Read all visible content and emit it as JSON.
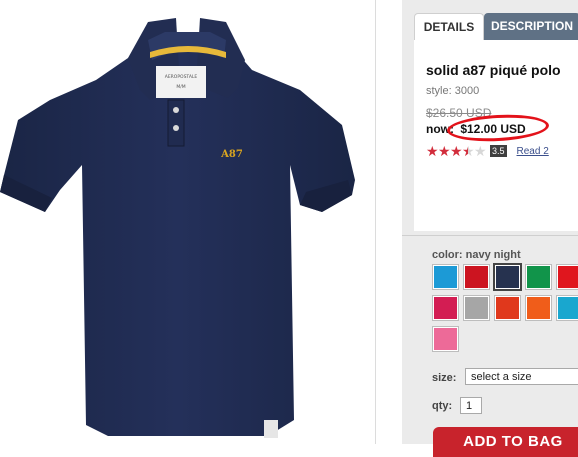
{
  "tabs": {
    "details": "DETAILS",
    "description": "DESCRIPTION"
  },
  "product": {
    "title": "solid a87 piqué polo",
    "style": "style: 3000",
    "old_price": "$26.50 USD",
    "now_label": "now: ",
    "now_price": "$12.00 USD",
    "rating": "3.5",
    "rating_value": 3.5,
    "rating_max": 5,
    "read_reviews": "Read 2",
    "shirt_label_brand": "AEROPOSTALE",
    "shirt_label_size": "M/M"
  },
  "color": {
    "label": "color: navy night",
    "swatches": [
      {
        "name": "teal-blue",
        "hex": "#1c9ad6",
        "selected": false
      },
      {
        "name": "red",
        "hex": "#cc1420",
        "selected": false
      },
      {
        "name": "navy-night",
        "hex": "#26324f",
        "selected": true
      },
      {
        "name": "green",
        "hex": "#11944a",
        "selected": false
      },
      {
        "name": "bright-red",
        "hex": "#e0161e",
        "selected": false
      },
      {
        "name": "raspberry",
        "hex": "#d31d53",
        "selected": false
      },
      {
        "name": "gray",
        "hex": "#a6a6a6",
        "selected": false
      },
      {
        "name": "orange-red",
        "hex": "#e0381c",
        "selected": false
      },
      {
        "name": "orange",
        "hex": "#f05d1a",
        "selected": false
      },
      {
        "name": "turquoise",
        "hex": "#19a7cf",
        "selected": false
      },
      {
        "name": "pink",
        "hex": "#ed6a98",
        "selected": false
      }
    ]
  },
  "size": {
    "label": "size:",
    "selected": "select a size"
  },
  "qty": {
    "label": "qty:",
    "value": "1"
  },
  "add_to_bag": "ADD TO BAG",
  "colors": {
    "accent": "#c8232c",
    "tab_active": "#5f7185",
    "circle": "#e3121a",
    "shirt": "#1f2a4d"
  }
}
